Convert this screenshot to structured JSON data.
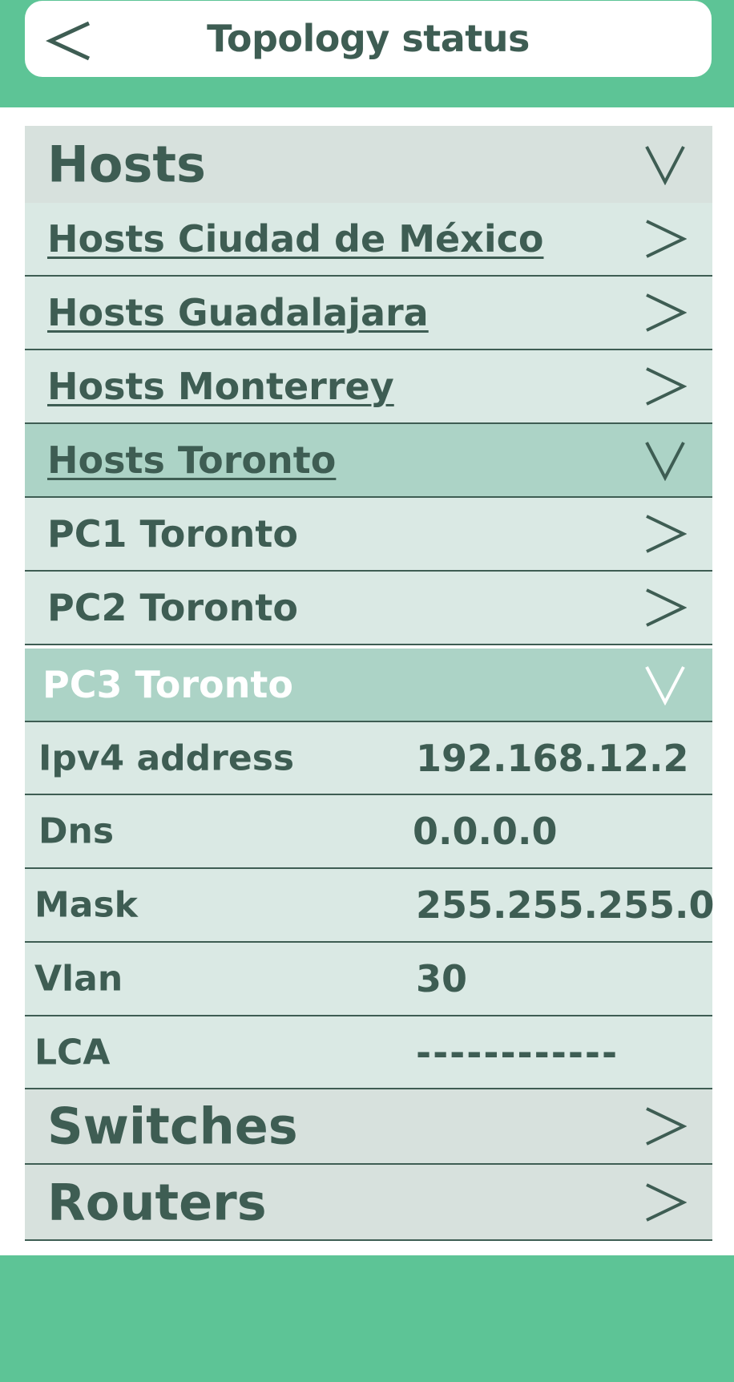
{
  "header": {
    "title": "Topology status",
    "back_icon": "chevron-left-icon"
  },
  "colors": {
    "brand_green": "#5dc496",
    "text": "#3e5d53",
    "section_bg": "#d7e1dd",
    "row_bg": "#dae9e4",
    "active_row_bg": "#acd3c6"
  },
  "hosts": {
    "label": "Hosts",
    "expanded": true,
    "groups": [
      {
        "label": "Hosts Ciudad de México",
        "expanded": false
      },
      {
        "label": "Hosts Guadalajara",
        "expanded": false
      },
      {
        "label": "Hosts Monterrey",
        "expanded": false
      },
      {
        "label": "Hosts Toronto",
        "expanded": true
      }
    ],
    "toronto_hosts": [
      {
        "label": "PC1 Toronto",
        "expanded": false
      },
      {
        "label": "PC2 Toronto",
        "expanded": false
      },
      {
        "label": "PC3 Toronto",
        "expanded": true
      }
    ],
    "pc3_details": [
      {
        "key": "Ipv4 address",
        "value": "192.168.12.2"
      },
      {
        "key": "Dns",
        "value": "0.0.0.0"
      },
      {
        "key": "Mask",
        "value": "255.255.255.0"
      },
      {
        "key": "Vlan",
        "value": "30"
      },
      {
        "key": "LCA",
        "value": "------------"
      }
    ]
  },
  "switches": {
    "label": "Switches",
    "expanded": false
  },
  "routers": {
    "label": "Routers",
    "expanded": false
  }
}
